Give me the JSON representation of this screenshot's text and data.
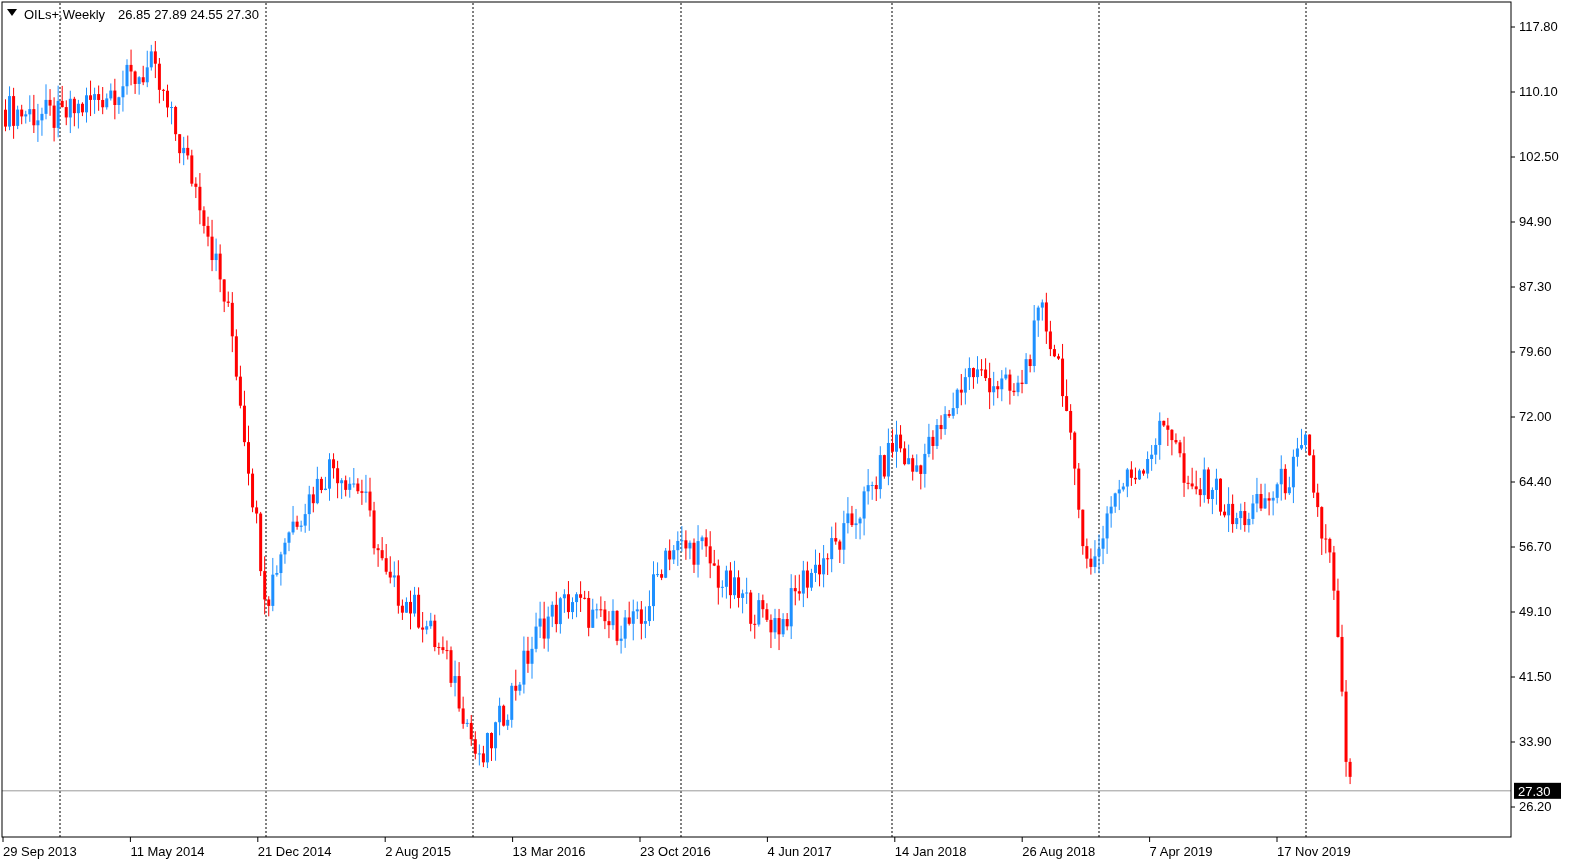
{
  "header": {
    "symbol": "OILs+,Weekly",
    "ohlc": "26.85 27.89 24.55 27.30"
  },
  "price_axis": {
    "labels": [
      "117.80",
      "110.10",
      "102.50",
      "94.90",
      "87.30",
      "79.60",
      "72.00",
      "64.40",
      "56.70",
      "49.10",
      "41.50",
      "33.90",
      "26.20"
    ],
    "current_price": "27.30"
  },
  "time_axis": {
    "labels": [
      "29 Sep 2013",
      "11 May 2014",
      "21 Dec 2014",
      "2 Aug 2015",
      "13 Mar 2016",
      "23 Oct 2016",
      "4 Jun 2017",
      "14 Jan 2018",
      "26 Aug 2018",
      "7 Apr 2019",
      "17 Nov 2019"
    ]
  }
}
